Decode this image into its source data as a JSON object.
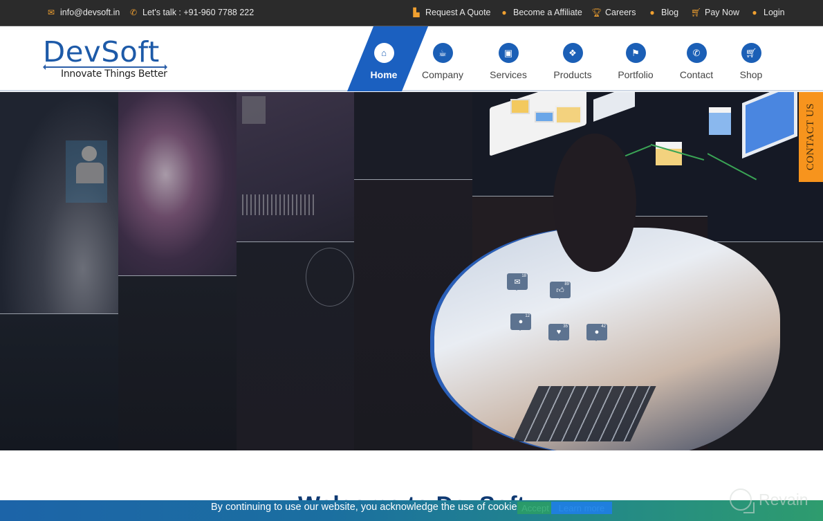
{
  "topbar": {
    "email": "info@devsoft.in",
    "phone": "Let's talk : +91-960 7788 222",
    "links": [
      {
        "label": "Request A Quote",
        "icon": "quote-document-icon"
      },
      {
        "label": "Become a Affiliate",
        "icon": "user-icon"
      },
      {
        "label": "Careers",
        "icon": "trophy-icon"
      },
      {
        "label": "Blog",
        "icon": "comment-icon"
      },
      {
        "label": "Pay Now",
        "icon": "cart-icon"
      },
      {
        "label": "Login",
        "icon": "user-icon"
      }
    ]
  },
  "header": {
    "logo_text": "DevSoft",
    "logo_tagline": "Innovate Things Better",
    "nav": [
      {
        "label": "Home",
        "icon": "home-icon",
        "active": true
      },
      {
        "label": "Company",
        "icon": "coffee-cup-icon",
        "active": false
      },
      {
        "label": "Services",
        "icon": "gift-icon",
        "active": false
      },
      {
        "label": "Products",
        "icon": "cubes-icon",
        "active": false
      },
      {
        "label": "Portfolio",
        "icon": "flag-icon",
        "active": false
      },
      {
        "label": "Contact",
        "icon": "phone-icon",
        "active": false
      },
      {
        "label": "Shop",
        "icon": "cart-icon",
        "active": false
      }
    ]
  },
  "hero": {
    "bubbles": [
      {
        "icon": "mail-icon",
        "count": "18"
      },
      {
        "icon": "thumbs-up-icon",
        "count": "89"
      },
      {
        "icon": "user-icon",
        "count": "12"
      },
      {
        "icon": "heart-icon",
        "count": "35"
      },
      {
        "icon": "chat-icon",
        "count": "42"
      }
    ]
  },
  "contact_tab": {
    "label": "CONTACT US"
  },
  "welcome": {
    "heading": "Welcome to DevSoft"
  },
  "cookie": {
    "message": "By continuing to use our website, you acknowledge the use of cookies.",
    "accept_label": "Accept",
    "more_label": "Learn more"
  },
  "watermark": {
    "label": "Revain"
  },
  "colors": {
    "brand_blue": "#1b60c0",
    "accent_orange": "#f7941d",
    "topbar_bg": "#2b2b2b"
  }
}
